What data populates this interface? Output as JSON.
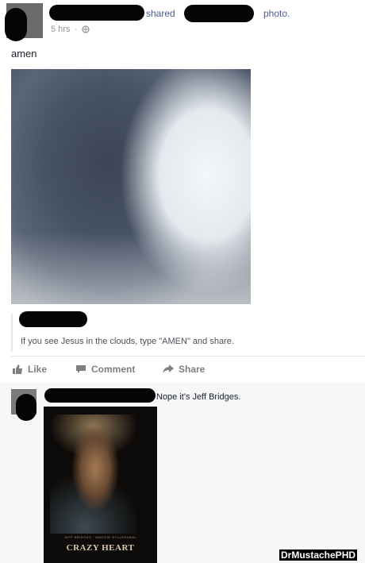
{
  "post": {
    "author_text": "shared",
    "shared_suffix": "photo.",
    "timestamp": "5 hrs",
    "separator": "·",
    "privacy_icon": "globe-icon",
    "text": "amen",
    "photo_caption": "If you see Jesus in the clouds, type \"AMEN\" and share."
  },
  "actions": {
    "like_label": "Like",
    "comment_label": "Comment",
    "share_label": "Share"
  },
  "comment": {
    "text": "Nope it's Jeff Bridges.",
    "image_title": "CRAZY HEART",
    "image_credits": "JEFF BRIDGES · MAGGIE GYLLENHAAL"
  },
  "watermark": "DrMustachePHD",
  "colors": {
    "link": "#4b5b92",
    "meta": "#90949c",
    "action": "#7f7f7f",
    "redaction": "#050505"
  }
}
